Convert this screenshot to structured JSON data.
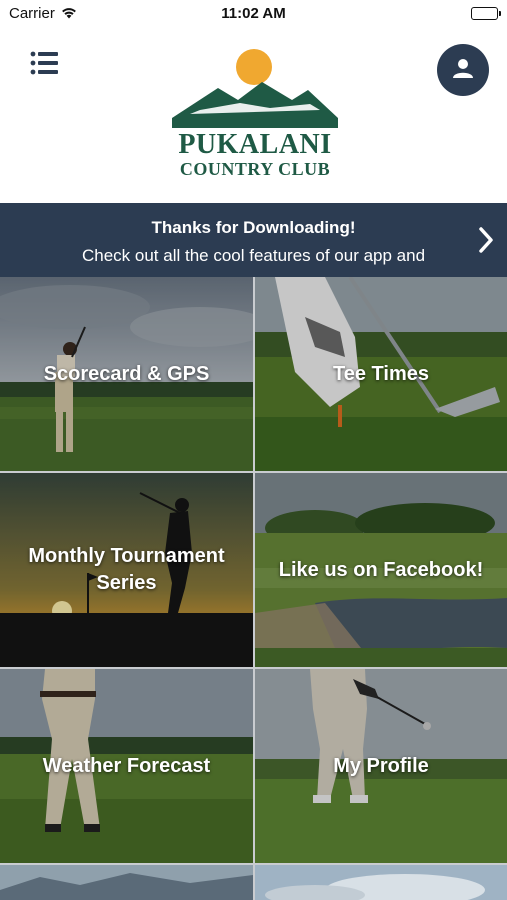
{
  "status_bar": {
    "carrier": "Carrier",
    "time": "11:02 AM",
    "icons": [
      "wifi-icon",
      "battery-icon"
    ]
  },
  "header": {
    "menu_icon": "hamburger-menu-icon",
    "profile_icon": "user-icon",
    "logo": {
      "name": "PUKALANI",
      "subtitle": "COUNTRY CLUB",
      "colors": {
        "sun": "#f0a830",
        "mountains": "#1f5a45"
      }
    }
  },
  "banner": {
    "title": "Thanks for Downloading!",
    "text": "Check out all the cool features of our app and",
    "icon": "chevron-right-icon",
    "background": "#2c3c52"
  },
  "tiles": [
    {
      "label": "Scorecard & GPS"
    },
    {
      "label": "Tee Times"
    },
    {
      "label": "Monthly Tournament Series"
    },
    {
      "label": "Like us on Facebook!"
    },
    {
      "label": "Weather Forecast"
    },
    {
      "label": "My Profile"
    },
    {
      "label": ""
    },
    {
      "label": ""
    }
  ],
  "colors": {
    "accent": "#2c3c52",
    "logo_green": "#1f5a45",
    "logo_sun": "#f0a830"
  }
}
